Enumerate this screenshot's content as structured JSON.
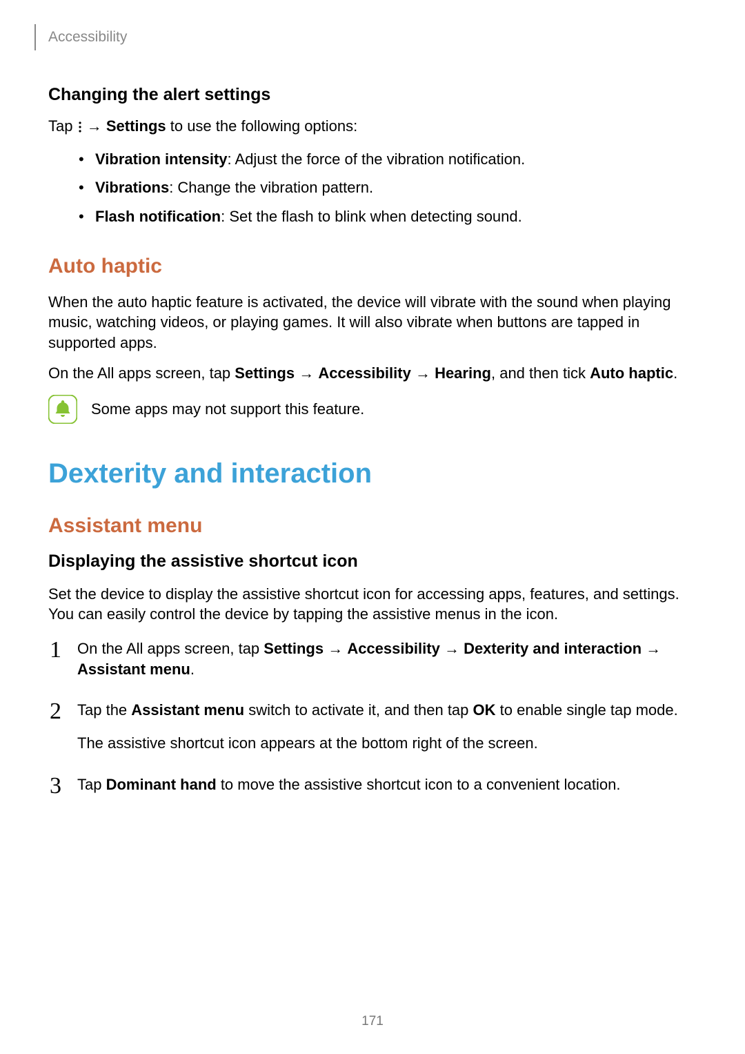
{
  "header": {
    "breadcrumb": "Accessibility"
  },
  "alert": {
    "heading": "Changing the alert settings",
    "intro_tap": "Tap ",
    "intro_arrow": " → ",
    "intro_settings": "Settings",
    "intro_rest": " to use the following options:",
    "items": [
      {
        "label": "Vibration intensity",
        "desc": ": Adjust the force of the vibration notification."
      },
      {
        "label": "Vibrations",
        "desc": ": Change the vibration pattern."
      },
      {
        "label": "Flash notification",
        "desc": ": Set the flash to blink when detecting sound."
      }
    ]
  },
  "auto_haptic": {
    "heading": "Auto haptic",
    "para1": "When the auto haptic feature is activated, the device will vibrate with the sound when playing music, watching videos, or playing games. It will also vibrate when buttons are tapped in supported apps.",
    "para2_pre": "On the All apps screen, tap ",
    "para2_settings": "Settings",
    "para2_arrow1": " → ",
    "para2_access": "Accessibility",
    "para2_arrow2": " → ",
    "para2_hearing": "Hearing",
    "para2_mid": ", and then tick ",
    "para2_autohaptic": "Auto haptic",
    "para2_end": ".",
    "note": "Some apps may not support this feature."
  },
  "dexterity": {
    "heading": "Dexterity and interaction",
    "assistant_heading": "Assistant menu",
    "sub_heading": "Displaying the assistive shortcut icon",
    "intro": "Set the device to display the assistive shortcut icon for accessing apps, features, and settings. You can easily control the device by tapping the assistive menus in the icon.",
    "steps": {
      "s1_pre": "On the All apps screen, tap ",
      "s1_settings": "Settings",
      "s1_arrow1": " → ",
      "s1_access": "Accessibility",
      "s1_arrow2": " → ",
      "s1_dex": "Dexterity and interaction",
      "s1_arrow3": " → ",
      "s1_assist": "Assistant menu",
      "s1_end": ".",
      "s2_pre": "Tap the ",
      "s2_assist": "Assistant menu",
      "s2_mid": " switch to activate it, and then tap ",
      "s2_ok": "OK",
      "s2_post": " to enable single tap mode.",
      "s2_extra": "The assistive shortcut icon appears at the bottom right of the screen.",
      "s3_pre": "Tap ",
      "s3_dom": "Dominant hand",
      "s3_post": " to move the assistive shortcut icon to a convenient location."
    }
  },
  "page_number": "171"
}
